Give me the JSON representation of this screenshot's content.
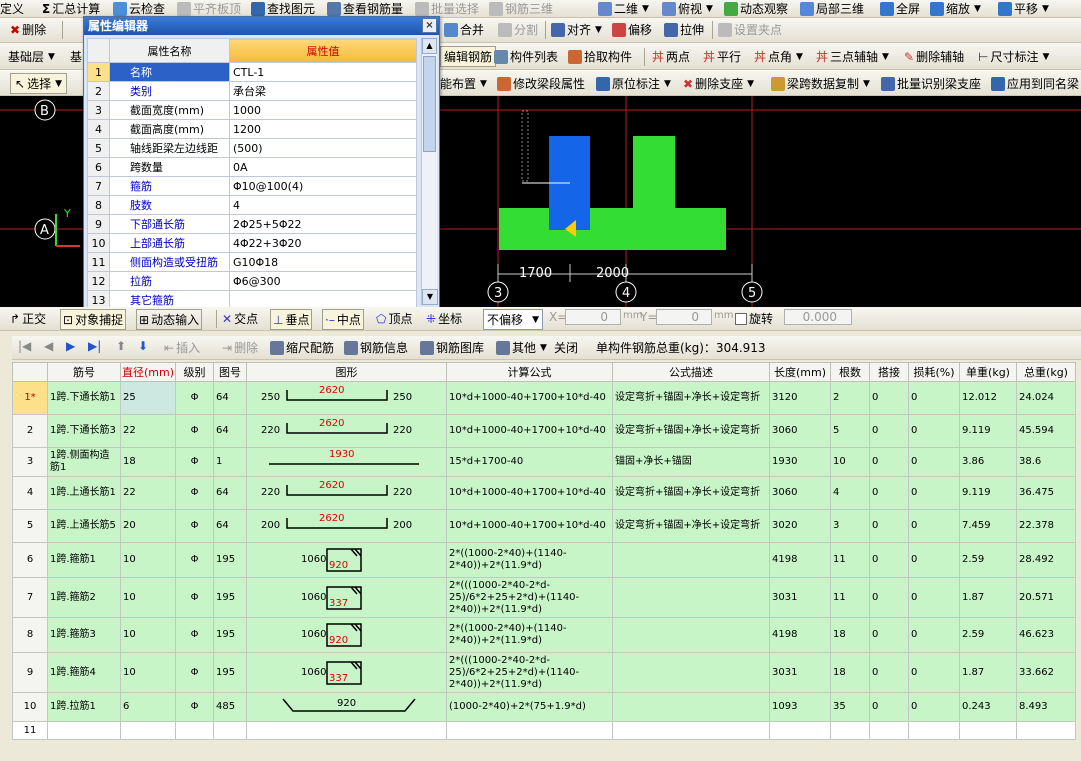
{
  "toolbar1": {
    "items": [
      "定义",
      "汇总计算",
      "云检查",
      "平齐板顶",
      "查找图元",
      "查看钢筋量",
      "批量选择",
      "钢筋三维",
      "二维",
      "俯视",
      "动态观察",
      "局部三维",
      "全屏",
      "缩放",
      "平移"
    ]
  },
  "toolbar2": {
    "items": [
      "删除",
      "合并",
      "分割",
      "对齐",
      "偏移",
      "拉伸",
      "设置夹点"
    ]
  },
  "toolbar3": {
    "layer": "基础层",
    "layer2": "基",
    "items": [
      "编辑钢筋",
      "构件列表",
      "拾取构件",
      "两点",
      "平行",
      "点角",
      "三点辅轴",
      "删除辅轴",
      "尺寸标注"
    ]
  },
  "toolbar4": {
    "select": "选择",
    "items": [
      "能布置",
      "修改梁段属性",
      "原位标注",
      "删除支座",
      "梁跨数据复制",
      "批量识别梁支座",
      "应用到同名梁"
    ]
  },
  "prop_editor": {
    "title": "属性编辑器",
    "close": "×",
    "col_name": "属性名称",
    "col_value": "属性值",
    "rows": [
      {
        "n": "1",
        "k": "名称",
        "v": "CTL-1",
        "blue": true
      },
      {
        "n": "2",
        "k": "类别",
        "v": "承台梁",
        "blue": true
      },
      {
        "n": "3",
        "k": "截面宽度(mm)",
        "v": "1000",
        "blue": false
      },
      {
        "n": "4",
        "k": "截面高度(mm)",
        "v": "1200",
        "blue": false
      },
      {
        "n": "5",
        "k": "轴线距梁左边线距",
        "v": "(500)",
        "blue": false
      },
      {
        "n": "6",
        "k": "跨数量",
        "v": "0A",
        "blue": false
      },
      {
        "n": "7",
        "k": "箍筋",
        "v": "Φ10@100(4)",
        "blue": true
      },
      {
        "n": "8",
        "k": "肢数",
        "v": "4",
        "blue": true
      },
      {
        "n": "9",
        "k": "下部通长筋",
        "v": "2Φ25+5Φ22",
        "blue": true
      },
      {
        "n": "10",
        "k": "上部通长筋",
        "v": "4Φ22+3Φ20",
        "blue": true
      },
      {
        "n": "11",
        "k": "侧面构造或受扭筋",
        "v": "G10Φ18",
        "blue": true
      },
      {
        "n": "12",
        "k": "拉筋",
        "v": "Φ6@300",
        "blue": true
      },
      {
        "n": "13",
        "k": "其它箍筋",
        "v": "",
        "blue": true
      }
    ]
  },
  "cad": {
    "axis_b": "B",
    "axis_a": "A",
    "axis_3": "3",
    "axis_4": "4",
    "axis_5": "5",
    "dim1": "1700",
    "dim2": "2000",
    "y_label": "Y"
  },
  "snapbar": {
    "items": [
      "正交",
      "对象捕捉",
      "动态输入",
      "交点",
      "垂点",
      "中点",
      "顶点",
      "坐标"
    ],
    "offset": "不偏移",
    "x_label": "X=",
    "x_val": "0",
    "y_label": "Y=",
    "y_val": "0",
    "mm": "mm",
    "rotate": "旋转",
    "rotate_val": "0.000"
  },
  "rebar_bar": {
    "items": [
      "插入",
      "删除",
      "缩尺配筋",
      "钢筋信息",
      "钢筋图库",
      "其他",
      "关闭"
    ],
    "total": "单构件钢筋总重(kg)：304.913"
  },
  "grid": {
    "headers": [
      "筋号",
      "直径(mm)",
      "级别",
      "图号",
      "图形",
      "计算公式",
      "公式描述",
      "长度(mm)",
      "根数",
      "搭接",
      "损耗(%)",
      "单重(kg)",
      "总重(kg)"
    ],
    "rows": [
      {
        "no": "1*",
        "name": "1跨.下通长筋1",
        "dia": "25",
        "grade": "Φ",
        "fig": "64",
        "sl": "250",
        "smid": "2620",
        "sr": "250",
        "formula": "10*d+1000-40+1700+10*d-40",
        "desc": "设定弯折+锚固+净长+设定弯折",
        "len": "3120",
        "cnt": "2",
        "lap": "0",
        "loss": "0",
        "unit": "12.012",
        "total": "24.024",
        "type": "bar"
      },
      {
        "no": "2",
        "name": "1跨.下通长筋3",
        "dia": "22",
        "grade": "Φ",
        "fig": "64",
        "sl": "220",
        "smid": "2620",
        "sr": "220",
        "formula": "10*d+1000-40+1700+10*d-40",
        "desc": "设定弯折+锚固+净长+设定弯折",
        "len": "3060",
        "cnt": "5",
        "lap": "0",
        "loss": "0",
        "unit": "9.119",
        "total": "45.594",
        "type": "bar"
      },
      {
        "no": "3",
        "name": "1跨.侧面构造筋1",
        "dia": "18",
        "grade": "Φ",
        "fig": "1",
        "sl": "",
        "smid": "1930",
        "sr": "",
        "formula": "15*d+1700-40",
        "desc": "锚固+净长+锚固",
        "len": "1930",
        "cnt": "10",
        "lap": "0",
        "loss": "0",
        "unit": "3.86",
        "total": "38.6",
        "type": "line"
      },
      {
        "no": "4",
        "name": "1跨.上通长筋1",
        "dia": "22",
        "grade": "Φ",
        "fig": "64",
        "sl": "220",
        "smid": "2620",
        "sr": "220",
        "formula": "10*d+1000-40+1700+10*d-40",
        "desc": "设定弯折+锚固+净长+设定弯折",
        "len": "3060",
        "cnt": "4",
        "lap": "0",
        "loss": "0",
        "unit": "9.119",
        "total": "36.475",
        "type": "bar"
      },
      {
        "no": "5",
        "name": "1跨.上通长筋5",
        "dia": "20",
        "grade": "Φ",
        "fig": "64",
        "sl": "200",
        "smid": "2620",
        "sr": "200",
        "formula": "10*d+1000-40+1700+10*d-40",
        "desc": "设定弯折+锚固+净长+设定弯折",
        "len": "3020",
        "cnt": "3",
        "lap": "0",
        "loss": "0",
        "unit": "7.459",
        "total": "22.378",
        "type": "bar"
      },
      {
        "no": "6",
        "name": "1跨.箍筋1",
        "dia": "10",
        "grade": "Φ",
        "fig": "195",
        "sl": "1060",
        "smid": "920",
        "sr": "",
        "formula": "2*((1000-2*40)+(1140-2*40))+2*(11.9*d)",
        "desc": "",
        "len": "4198",
        "cnt": "11",
        "lap": "0",
        "loss": "0",
        "unit": "2.59",
        "total": "28.492",
        "type": "stirrup"
      },
      {
        "no": "7",
        "name": "1跨.箍筋2",
        "dia": "10",
        "grade": "Φ",
        "fig": "195",
        "sl": "1060",
        "smid": "337",
        "sr": "",
        "formula": "2*(((1000-2*40-2*d-25)/6*2+25+2*d)+(1140-2*40))+2*(11.9*d)",
        "desc": "",
        "len": "3031",
        "cnt": "11",
        "lap": "0",
        "loss": "0",
        "unit": "1.87",
        "total": "20.571",
        "type": "stirrup"
      },
      {
        "no": "8",
        "name": "1跨.箍筋3",
        "dia": "10",
        "grade": "Φ",
        "fig": "195",
        "sl": "1060",
        "smid": "920",
        "sr": "",
        "formula": "2*((1000-2*40)+(1140-2*40))+2*(11.9*d)",
        "desc": "",
        "len": "4198",
        "cnt": "18",
        "lap": "0",
        "loss": "0",
        "unit": "2.59",
        "total": "46.623",
        "type": "stirrup"
      },
      {
        "no": "9",
        "name": "1跨.箍筋4",
        "dia": "10",
        "grade": "Φ",
        "fig": "195",
        "sl": "1060",
        "smid": "337",
        "sr": "",
        "formula": "2*(((1000-2*40-2*d-25)/6*2+25+2*d)+(1140-2*40))+2*(11.9*d)",
        "desc": "",
        "len": "3031",
        "cnt": "18",
        "lap": "0",
        "loss": "0",
        "unit": "1.87",
        "total": "33.662",
        "type": "stirrup"
      },
      {
        "no": "10",
        "name": "1跨.拉筋1",
        "dia": "6",
        "grade": "Φ",
        "fig": "485",
        "sl": "",
        "smid": "920",
        "sr": "",
        "formula": "(1000-2*40)+2*(75+1.9*d)",
        "desc": "",
        "len": "1093",
        "cnt": "35",
        "lap": "0",
        "loss": "0",
        "unit": "0.243",
        "total": "8.493",
        "type": "tie"
      },
      {
        "no": "11",
        "name": "",
        "dia": "",
        "grade": "",
        "fig": "",
        "sl": "",
        "smid": "",
        "sr": "",
        "formula": "",
        "desc": "",
        "len": "",
        "cnt": "",
        "lap": "",
        "loss": "",
        "unit": "",
        "total": "",
        "type": "empty"
      }
    ]
  }
}
